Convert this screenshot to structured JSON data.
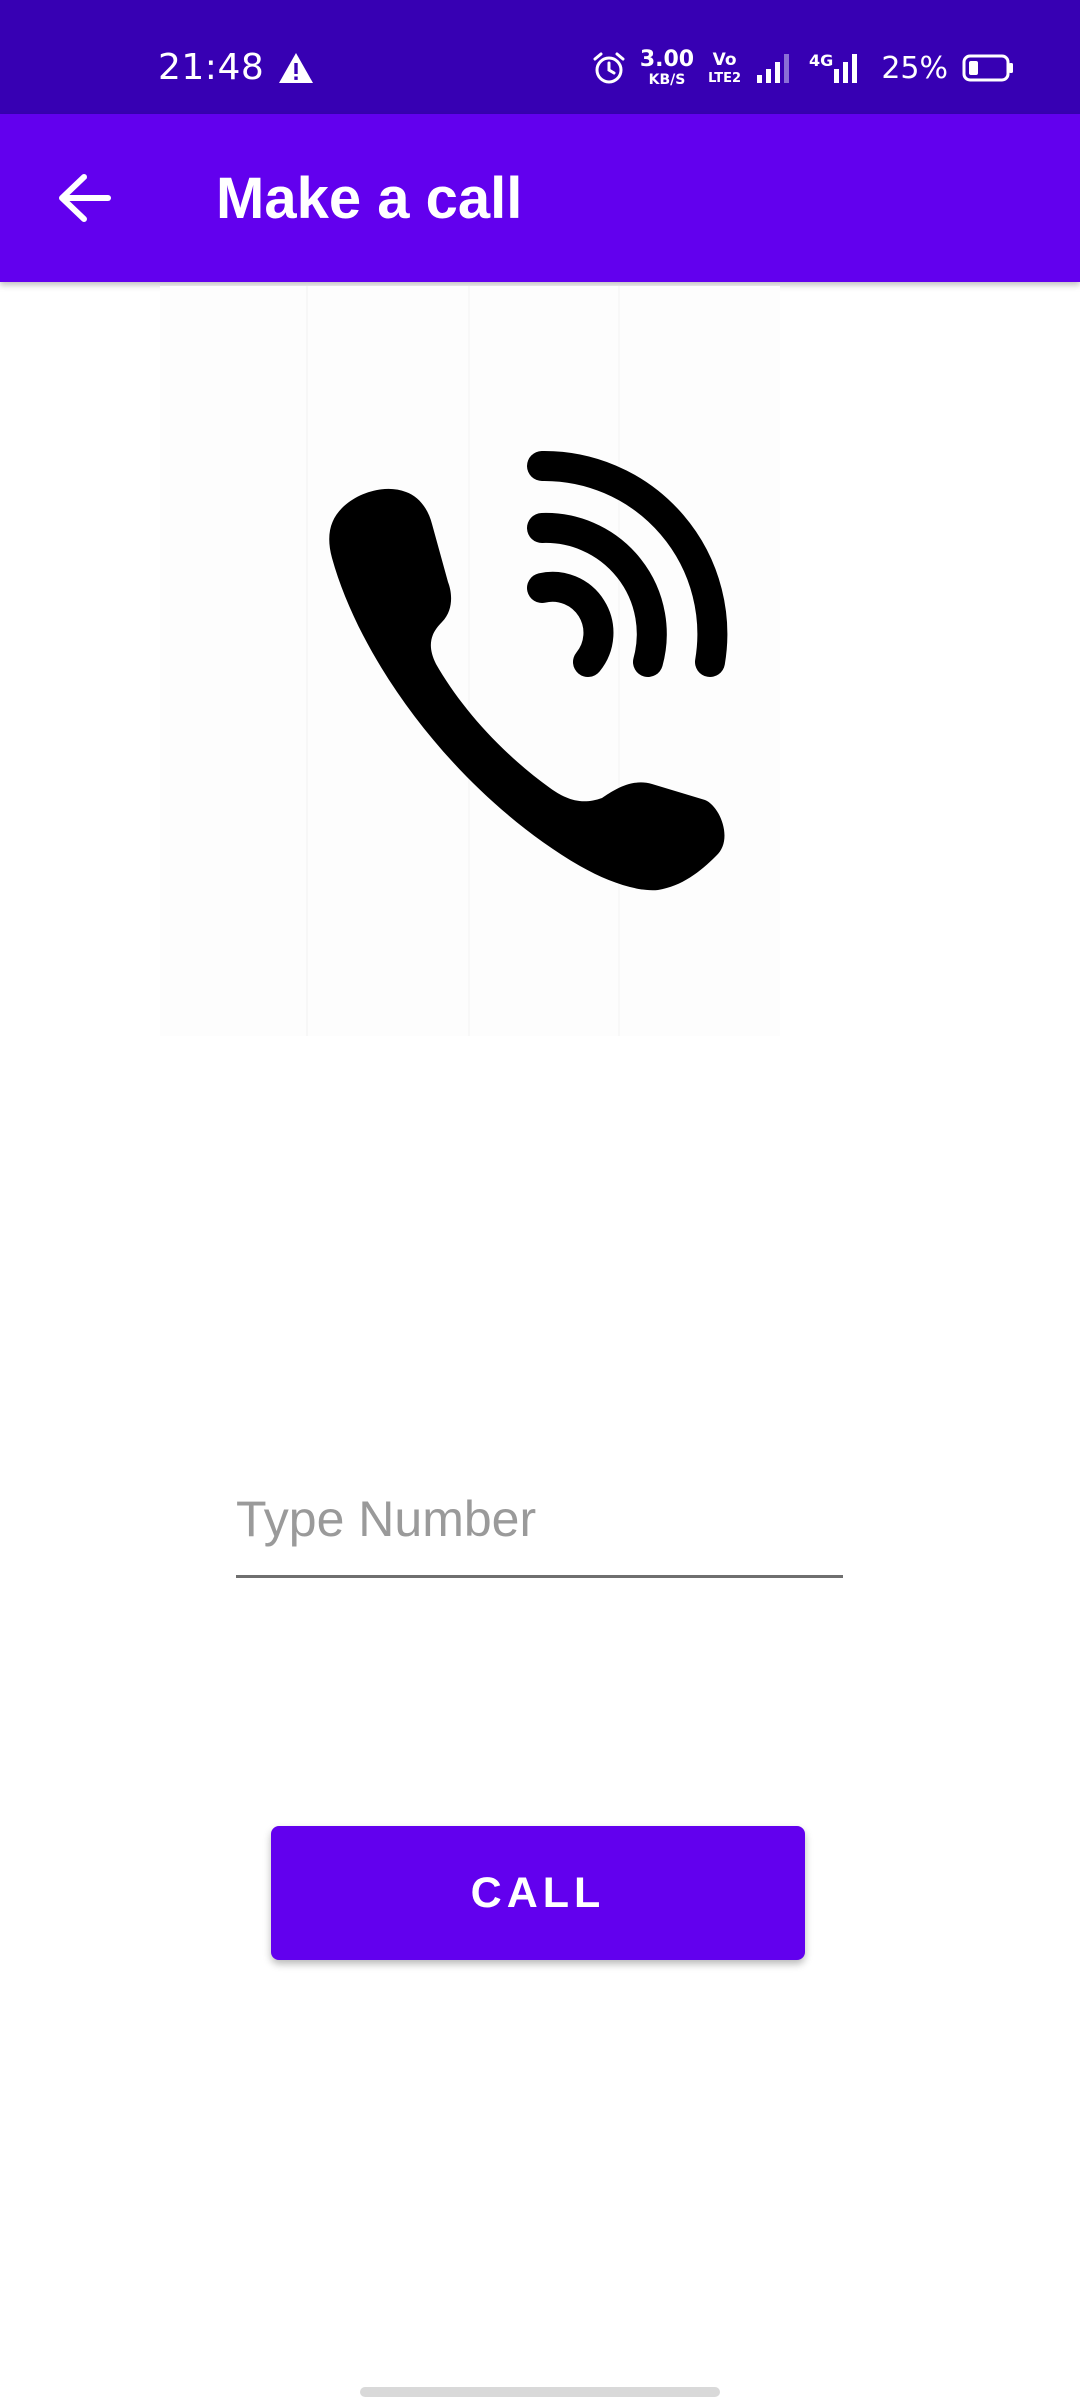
{
  "status_bar": {
    "time": "21:48",
    "speed_value": "3.00",
    "speed_unit": "KB/S",
    "volte_top": "Vo",
    "volte_bottom": "LTE2",
    "network_type": "4G",
    "battery_percent": "25%",
    "icons": [
      "warning-icon",
      "alarm-icon",
      "signal-icon",
      "battery-icon"
    ]
  },
  "app_bar": {
    "title": "Make a call",
    "back_icon": "arrow-left-icon"
  },
  "hero": {
    "icon": "phone-ringing-icon"
  },
  "form": {
    "number_placeholder": "Type Number",
    "number_value": ""
  },
  "actions": {
    "call_label": "CALL"
  },
  "colors": {
    "status_bar": "#3700b3",
    "primary": "#6200ee",
    "on_primary": "#ffffff"
  }
}
